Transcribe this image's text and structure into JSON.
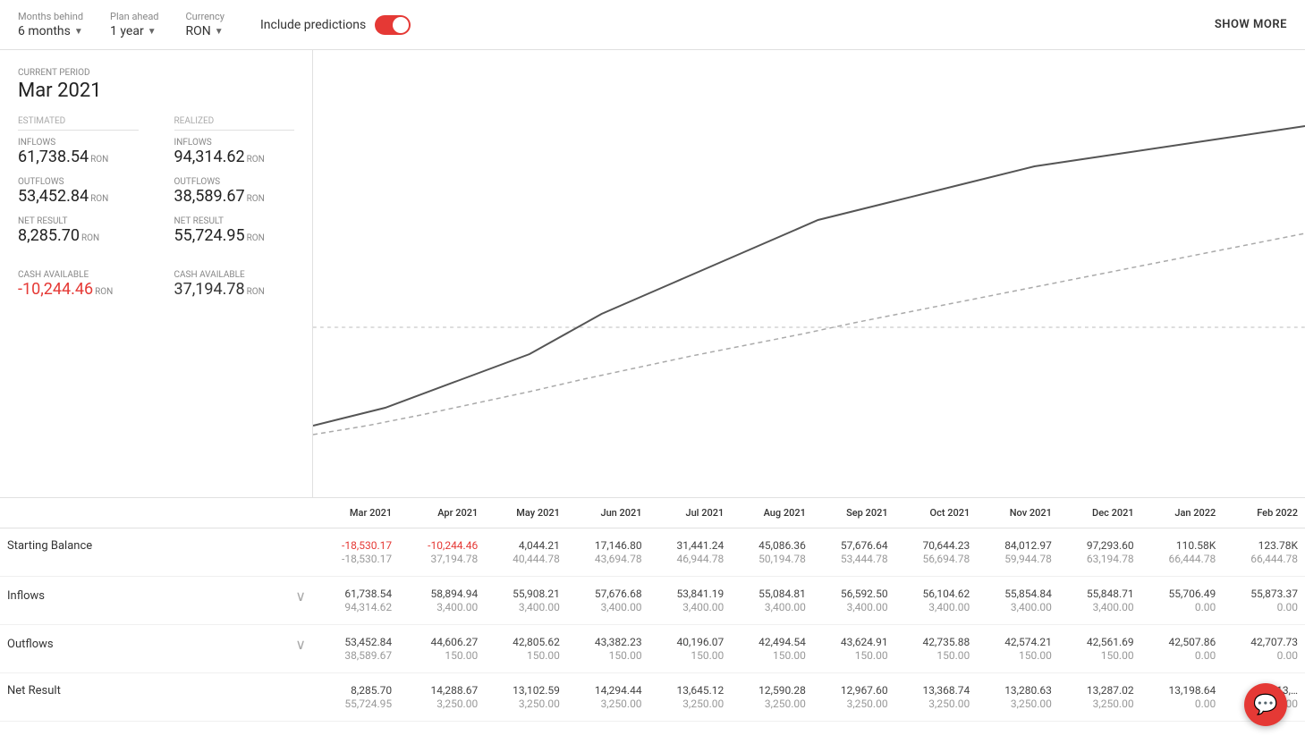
{
  "topbar": {
    "months_behind_label": "Months behind",
    "months_behind_value": "6 months",
    "plan_ahead_label": "Plan ahead",
    "plan_ahead_value": "1 year",
    "currency_label": "Currency",
    "currency_value": "RON",
    "predictions_label": "Include predictions",
    "show_more_label": "SHOW MORE"
  },
  "left": {
    "period_label": "CURRENT PERIOD",
    "period_value": "Mar 2021",
    "estimated_label": "ESTIMATED",
    "realized_label": "REALIZED",
    "inflows_label": "INFLOWS",
    "outflows_label": "OUTFLOWS",
    "net_result_label": "NET RESULT",
    "cash_available_label": "CASH AVAILABLE",
    "estimated": {
      "inflows": "61,738.54",
      "inflows_currency": "RON",
      "outflows": "53,452.84",
      "outflows_currency": "RON",
      "net_result": "8,285.70",
      "net_result_currency": "RON",
      "cash_available": "-10,244.46",
      "cash_available_currency": "RON"
    },
    "realized": {
      "inflows": "94,314.62",
      "inflows_currency": "RON",
      "outflows": "38,589.67",
      "outflows_currency": "RON",
      "net_result": "55,724.95",
      "net_result_currency": "RON",
      "cash_available": "37,194.78",
      "cash_available_currency": "RON"
    }
  },
  "table": {
    "columns": [
      "",
      "Mar 2021",
      "Apr 2021",
      "May 2021",
      "Jun 2021",
      "Jul 2021",
      "Aug 2021",
      "Sep 2021",
      "Oct 2021",
      "Nov 2021",
      "Dec 2021",
      "Jan 2022",
      "Feb 2022"
    ],
    "starting_balance": {
      "label": "Starting Balance",
      "rows": [
        [
          "-18,530.17",
          "-10,244.46",
          "4,044.21",
          "17,146.80",
          "31,441.24",
          "45,086.36",
          "57,676.64",
          "70,644.23",
          "84,012.97",
          "97,293.60",
          "110.58K",
          "123.78K"
        ],
        [
          "-18,530.17",
          "37,194.78",
          "40,444.78",
          "43,694.78",
          "46,944.78",
          "50,194.78",
          "53,444.78",
          "56,694.78",
          "59,944.78",
          "63,194.78",
          "66,444.78",
          "66,444.78"
        ]
      ]
    },
    "inflows": {
      "label": "Inflows",
      "rows": [
        [
          "61,738.54",
          "58,894.94",
          "55,908.21",
          "57,676.68",
          "53,841.19",
          "55,084.81",
          "56,592.50",
          "56,104.62",
          "55,854.84",
          "55,848.71",
          "55,706.49",
          "55,873.37"
        ],
        [
          "94,314.62",
          "3,400.00",
          "3,400.00",
          "3,400.00",
          "3,400.00",
          "3,400.00",
          "3,400.00",
          "3,400.00",
          "3,400.00",
          "3,400.00",
          "0.00",
          "0.00"
        ]
      ]
    },
    "outflows": {
      "label": "Outflows",
      "rows": [
        [
          "53,452.84",
          "44,606.27",
          "42,805.62",
          "43,382.23",
          "40,196.07",
          "42,494.54",
          "43,624.91",
          "42,735.88",
          "42,574.21",
          "42,561.69",
          "42,507.86",
          "42,707.73"
        ],
        [
          "38,589.67",
          "150.00",
          "150.00",
          "150.00",
          "150.00",
          "150.00",
          "150.00",
          "150.00",
          "150.00",
          "150.00",
          "0.00",
          "0.00"
        ]
      ]
    },
    "net_result": {
      "label": "Net Result",
      "rows": [
        [
          "8,285.70",
          "14,288.67",
          "13,102.59",
          "14,294.44",
          "13,645.12",
          "12,590.28",
          "12,967.60",
          "13,368.74",
          "13,280.63",
          "13,287.02",
          "13,198.64",
          "13,…"
        ],
        [
          "55,724.95",
          "3,250.00",
          "3,250.00",
          "3,250.00",
          "3,250.00",
          "3,250.00",
          "3,250.00",
          "3,250.00",
          "3,250.00",
          "3,250.00",
          "0.00",
          "0.00"
        ]
      ]
    }
  }
}
